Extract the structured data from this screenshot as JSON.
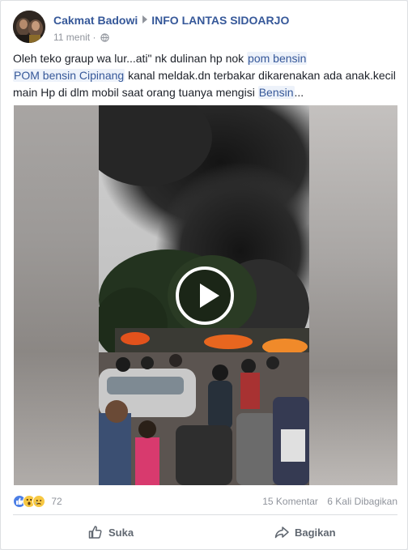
{
  "post": {
    "author": "Cakmat Badowi",
    "group": "INFO LANTAS SIDOARJO",
    "time": "11 menit",
    "separator": "·",
    "text": {
      "part1": "Oleh teko graup wa lur...ati\" nk dulinan hp nok ",
      "link1": "pom bensin",
      "part2": "",
      "link2": "POM bensin Cipinang",
      "part3": " kanal meldak.dn terbakar dikarenakan ada anak.kecil main Hp di dlm mobil saat orang tuanya mengisi ",
      "link3": "Bensin",
      "part4": "..."
    }
  },
  "stats": {
    "reaction_count": "72",
    "comments": "15 Komentar",
    "shares": "6 Kali Dibagikan"
  },
  "actions": {
    "like_label": "Suka",
    "share_label": "Bagikan"
  },
  "colors": {
    "link": "#365899",
    "meta": "#90949c",
    "like_blue": "#4d7fe5"
  }
}
